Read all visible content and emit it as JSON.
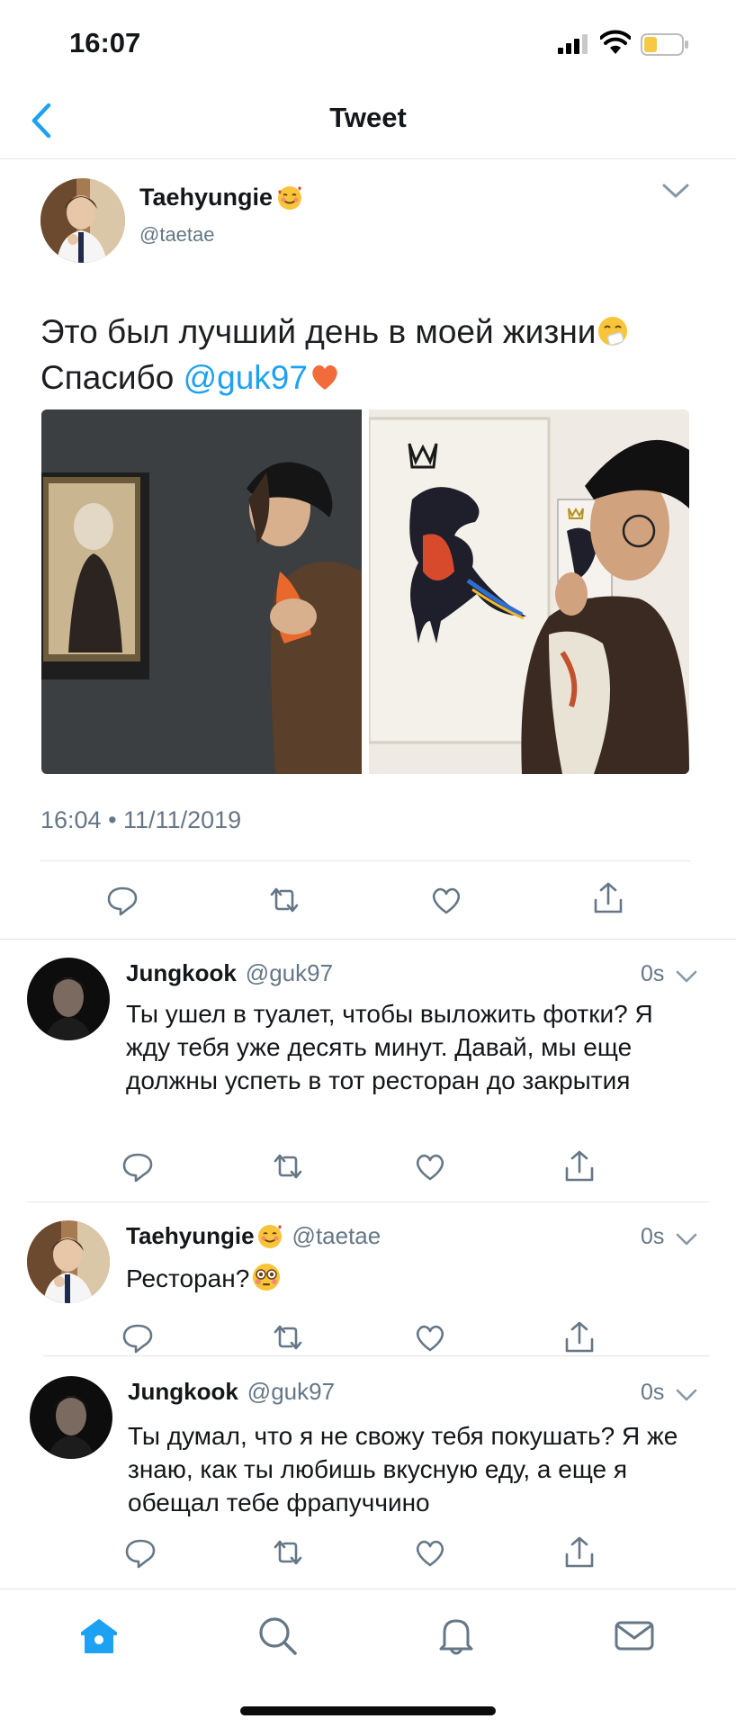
{
  "status_bar": {
    "time": "16:07"
  },
  "nav": {
    "title": "Tweet",
    "back_icon": "chevron-left-icon"
  },
  "colors": {
    "accent": "#1da1f2",
    "secondary_text": "#657786",
    "heart_red": "#e8432c"
  },
  "main_tweet": {
    "name": "Taehyungie",
    "name_emoji": "smiling-face-with-hearts",
    "handle": "@taetae",
    "text_part1": "Это был лучший день в моей жизни",
    "text_emoji": "sneezing-face",
    "text_part2": " Спасибо ",
    "mention": "@guk97",
    "mention_emoji": "orange-heart",
    "timestamp": "16:04 • 11/11/2019",
    "media": [
      {
        "description_icon": "photo-gallery-portrait"
      },
      {
        "description_icon": "photo-dinosaur-painting"
      }
    ]
  },
  "replies": [
    {
      "name": "Jungkook",
      "handle": "@guk97",
      "time": "0s",
      "text": "Ты ушел в туалет, чтобы выложить фотки? Я жду тебя уже десять минут. Давай, мы еще должны успеть в тот ресторан до закрытия"
    },
    {
      "name": "Taehyungie",
      "name_emoji": "smiling-face-with-hearts",
      "handle": "@taetae",
      "time": "0s",
      "text": "Ресторан?",
      "text_emoji": "flushed-face"
    },
    {
      "name": "Jungkook",
      "handle": "@guk97",
      "time": "0s",
      "text": "Ты думал, что я не свожу тебя покушать? Я же знаю, как ты любишь вкусную еду, а еще я обещал тебе фрапуччино"
    }
  ],
  "tab_bar": {
    "tabs": [
      "home-icon",
      "search-icon",
      "notifications-icon",
      "messages-icon"
    ],
    "active": "home-icon"
  }
}
